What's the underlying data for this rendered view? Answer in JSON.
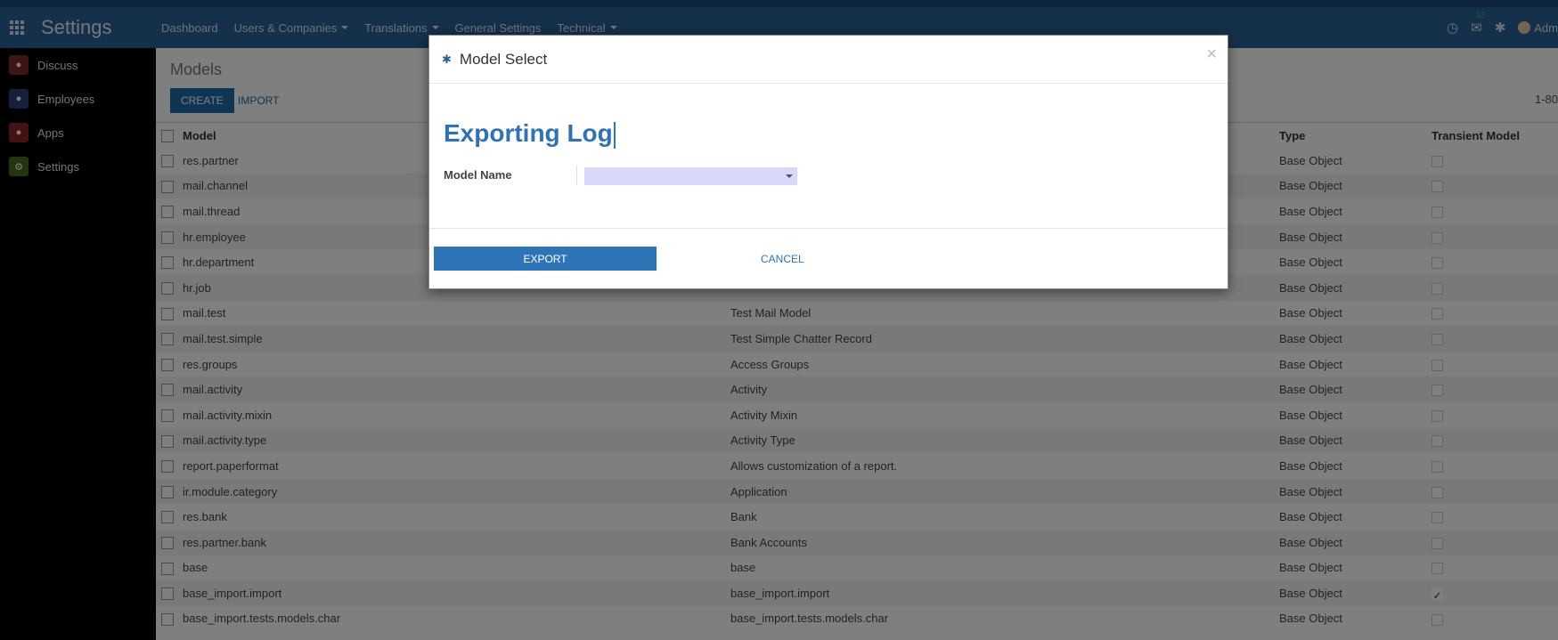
{
  "navbar": {
    "app_name": "Settings",
    "menu": [
      {
        "label": "Dashboard",
        "dropdown": false
      },
      {
        "label": "Users & Companies",
        "dropdown": true
      },
      {
        "label": "Translations",
        "dropdown": true
      },
      {
        "label": "General Settings",
        "dropdown": false
      },
      {
        "label": "Technical",
        "dropdown": true
      }
    ],
    "messages_count": "12",
    "user_label": "Adm"
  },
  "sidebar": {
    "items": [
      {
        "label": "Discuss"
      },
      {
        "label": "Employees"
      },
      {
        "label": "Apps"
      },
      {
        "label": "Settings"
      }
    ]
  },
  "control_panel": {
    "title": "Models",
    "create_label": "CREATE",
    "import_label": "IMPORT",
    "pager": "1-80"
  },
  "list": {
    "headers": {
      "model": "Model",
      "description": "",
      "type": "Type",
      "transient": "Transient Model"
    },
    "rows": [
      {
        "model": "res.partner",
        "description": "",
        "type": "Base Object",
        "transient": false
      },
      {
        "model": "mail.channel",
        "description": "",
        "type": "Base Object",
        "transient": false
      },
      {
        "model": "mail.thread",
        "description": "",
        "type": "Base Object",
        "transient": false
      },
      {
        "model": "hr.employee",
        "description": "",
        "type": "Base Object",
        "transient": false
      },
      {
        "model": "hr.department",
        "description": "",
        "type": "Base Object",
        "transient": false
      },
      {
        "model": "hr.job",
        "description": "",
        "type": "Base Object",
        "transient": false
      },
      {
        "model": "mail.test",
        "description": "Test Mail Model",
        "type": "Base Object",
        "transient": false
      },
      {
        "model": "mail.test.simple",
        "description": "Test Simple Chatter Record",
        "type": "Base Object",
        "transient": false
      },
      {
        "model": "res.groups",
        "description": "Access Groups",
        "type": "Base Object",
        "transient": false
      },
      {
        "model": "mail.activity",
        "description": "Activity",
        "type": "Base Object",
        "transient": false
      },
      {
        "model": "mail.activity.mixin",
        "description": "Activity Mixin",
        "type": "Base Object",
        "transient": false
      },
      {
        "model": "mail.activity.type",
        "description": "Activity Type",
        "type": "Base Object",
        "transient": false
      },
      {
        "model": "report.paperformat",
        "description": "Allows customization of a report.",
        "type": "Base Object",
        "transient": false
      },
      {
        "model": "ir.module.category",
        "description": "Application",
        "type": "Base Object",
        "transient": false
      },
      {
        "model": "res.bank",
        "description": "Bank",
        "type": "Base Object",
        "transient": false
      },
      {
        "model": "res.partner.bank",
        "description": "Bank Accounts",
        "type": "Base Object",
        "transient": false
      },
      {
        "model": "base",
        "description": "base",
        "type": "Base Object",
        "transient": false
      },
      {
        "model": "base_import.import",
        "description": "base_import.import",
        "type": "Base Object",
        "transient": true
      },
      {
        "model": "base_import.tests.models.char",
        "description": "base_import.tests.models.char",
        "type": "Base Object",
        "transient": false
      }
    ]
  },
  "modal": {
    "title": "Model Select",
    "close_symbol": "×",
    "record_name": "Exporting Log",
    "field_label": "Model Name",
    "model_name_value": "",
    "export_label": "EXPORT",
    "cancel_label": "CANCEL"
  }
}
